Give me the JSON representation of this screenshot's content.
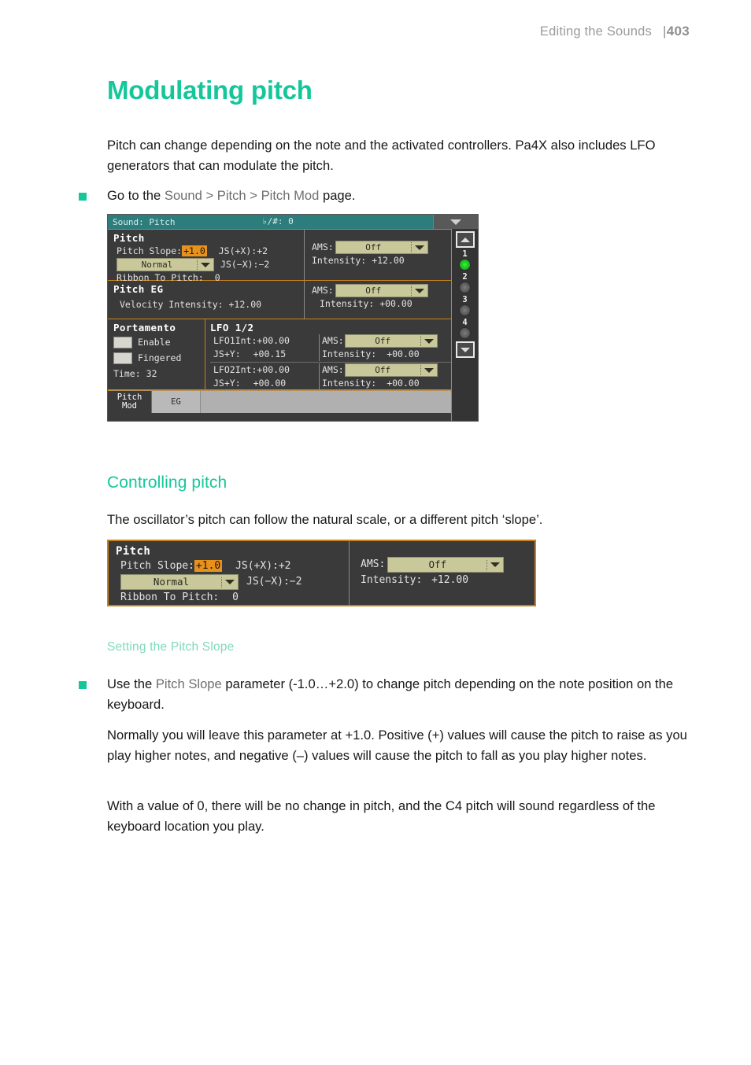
{
  "page_header": {
    "running_title": "Editing the Sounds",
    "page_number": "403",
    "separator": "|"
  },
  "chapter": {
    "title": "Modulating pitch",
    "intro": "Pitch can change depending on the note and the activated controllers. Pa4X also includes LFO generators that can modulate the pitch.",
    "goto_prefix": "Go to the ",
    "goto_path": "Sound > Pitch > Pitch Mod",
    "goto_suffix": " page."
  },
  "section": {
    "title": "Controlling pitch",
    "intro": "The oscillator’s pitch can follow the natural scale, or a different pitch ‘slope’.",
    "subsection_title": "Setting the Pitch Slope",
    "bullet_prefix": "Use the ",
    "bullet_param": "Pitch Slope",
    "bullet_suffix": " parameter (-1.0…+2.0) to change pitch depending on the note position on the keyboard.",
    "para_normally": "Normally you will leave this parameter at +1.0. Positive (+) values will cause the pitch to raise as you play higher notes, and negative (–) values will cause the pitch to fall as you play higher notes.",
    "para_zero": "With a value of 0, there will be no change in pitch, and the C4 pitch will sound regardless of the keyboard location you play."
  },
  "colors": {
    "accent_teal": "#14c79a",
    "subheading_teal": "#7fd9bd",
    "device_orange": "#e8921e",
    "device_titlebar": "#2d7d7d",
    "device_combo": "#c8c89b",
    "led_on": "#19b81d"
  },
  "device_screenshot_1": {
    "titlebar": {
      "title": "Sound: Pitch",
      "middle": "♭/#: 0",
      "menu_icon": "chevron-down-icon"
    },
    "pitch_zone": {
      "heading": "Pitch",
      "slope_label": "Pitch Slope:",
      "slope_value": "+1.0",
      "curve_value": "Normal",
      "ribbon_label": "Ribbon To Pitch:",
      "ribbon_value": "0",
      "js_plus": "JS(+X):+2",
      "js_minus": "JS(−X):−2",
      "ams_label": "AMS:",
      "ams_value": "Off",
      "intensity_label": "Intensity:",
      "intensity_value": "+12.00"
    },
    "pitch_eg_zone": {
      "heading": "Pitch EG",
      "velocity_label": "Velocity Intensity:",
      "velocity_value": "+12.00",
      "ams_label": "AMS:",
      "ams_value": "Off",
      "intensity_label": "Intensity:",
      "intensity_value": "+00.00"
    },
    "portamento_zone": {
      "heading": "Portamento",
      "enable_label": "Enable",
      "enable_checked": false,
      "fingered_label": "Fingered",
      "fingered_checked": false,
      "time_label": "Time:",
      "time_value": "32"
    },
    "lfo_zone": {
      "heading": "LFO 1/2",
      "lfo1": {
        "int_label": "LFO1Int:",
        "int_value": "+00.00",
        "jsy_label": "JS+Y:",
        "jsy_value": "+00.15",
        "ams_label": "AMS:",
        "ams_value": "Off",
        "intensity_label": "Intensity:",
        "intensity_value": "+00.00"
      },
      "lfo2": {
        "int_label": "LFO2Int:",
        "int_value": "+00.00",
        "jsy_label": "JS+Y:",
        "jsy_value": "+00.00",
        "ams_label": "AMS:",
        "ams_value": "Off",
        "intensity_label": "Intensity:",
        "intensity_value": "+00.00"
      }
    },
    "led_strip": {
      "up_icon": "chevron-up-icon",
      "down_icon": "chevron-down-icon",
      "leds": [
        {
          "number": "1",
          "state": "on"
        },
        {
          "number": "2",
          "state": "off"
        },
        {
          "number": "3",
          "state": "off"
        },
        {
          "number": "4",
          "state": "off"
        }
      ]
    },
    "tabs": [
      {
        "line1": "Pitch",
        "line2": "Mod",
        "active": true
      },
      {
        "line1": "EG",
        "line2": "",
        "active": false
      }
    ]
  },
  "device_screenshot_2": {
    "heading": "Pitch",
    "slope_label": "Pitch Slope:",
    "slope_value": "+1.0",
    "curve_value": "Normal",
    "ribbon_label": "Ribbon To Pitch:",
    "ribbon_value": "0",
    "js_plus": "JS(+X):+2",
    "js_minus": "JS(−X):−2",
    "ams_label": "AMS:",
    "ams_value": "Off",
    "intensity_label": "Intensity:",
    "intensity_value": "+12.00"
  }
}
